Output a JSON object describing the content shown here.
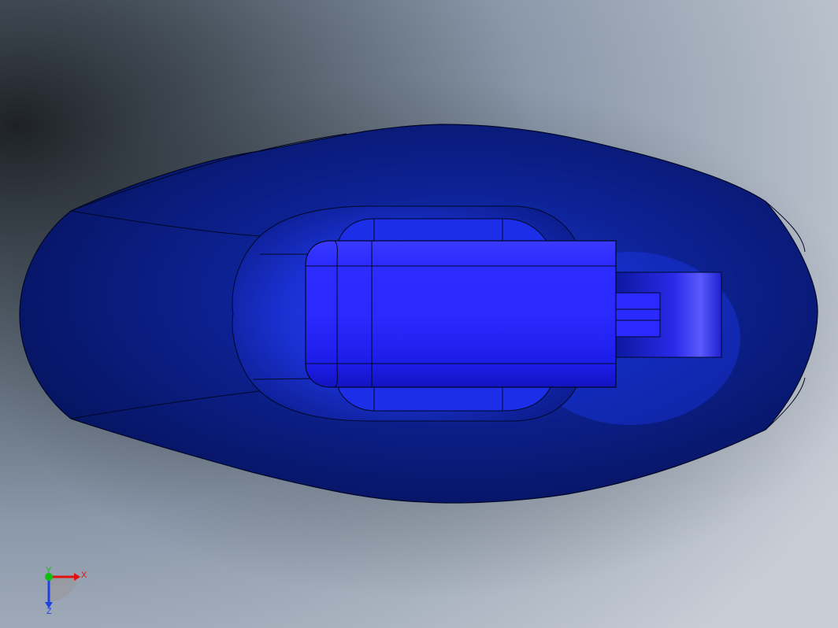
{
  "viewport": {
    "background_colors": {
      "dark": "#1e2227",
      "mid": "#7f8fa0",
      "light": "#c9ced6"
    }
  },
  "model": {
    "body_color": "#0a1e78",
    "body_highlight": "#1632c8",
    "insert_color": "#2828ff",
    "edge_color": "#000828"
  },
  "triad": {
    "x_label": "X",
    "y_label": "Y",
    "z_label": "Z",
    "x_color": "#e01010",
    "y_color": "#10c010",
    "z_color": "#2040e0"
  }
}
